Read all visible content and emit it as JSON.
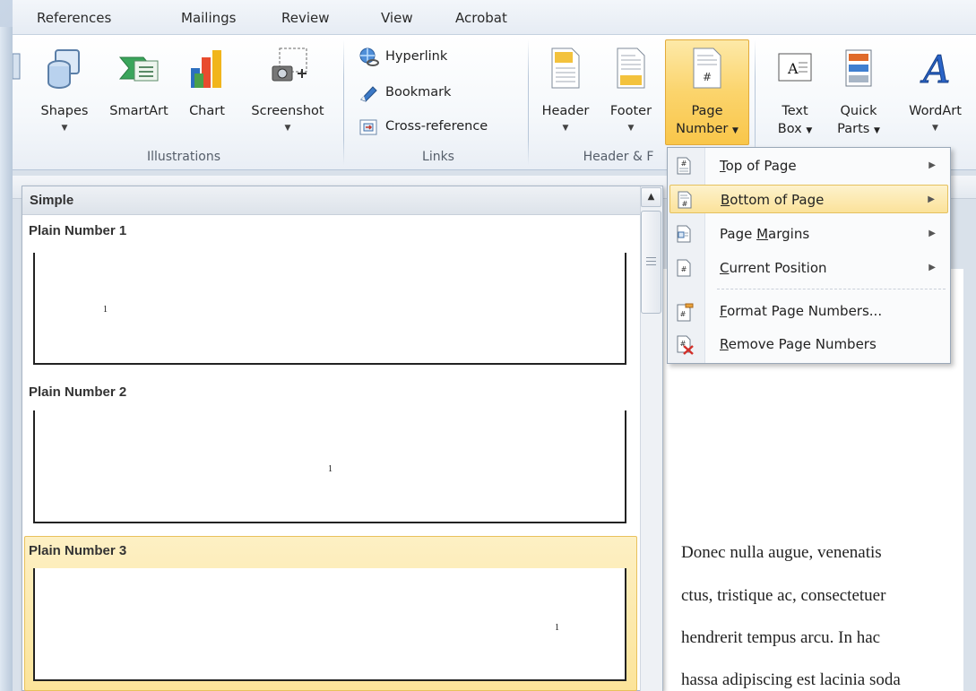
{
  "tabs": [
    "References",
    "Mailings",
    "Review",
    "View",
    "Acrobat"
  ],
  "ribbon": {
    "illustrations": {
      "label": "Illustrations",
      "buttons": [
        "Shapes",
        "SmartArt",
        "Chart",
        "Screenshot"
      ]
    },
    "links": {
      "label": "Links",
      "buttons": [
        "Hyperlink",
        "Bookmark",
        "Cross-reference"
      ]
    },
    "header_footer": {
      "label": "Header & F",
      "header": "Header",
      "footer": "Footer",
      "page_number_line1": "Page",
      "page_number_line2": "Number"
    },
    "text": {
      "text_box_line1": "Text",
      "text_box_line2": "Box",
      "quick_parts_line1": "Quick",
      "quick_parts_line2": "Parts",
      "wordart": "WordArt"
    }
  },
  "gallery": {
    "header": "Simple",
    "items": [
      {
        "title": "Plain Number 1",
        "number": "1"
      },
      {
        "title": "Plain Number 2",
        "number": "1"
      },
      {
        "title": "Plain Number 3",
        "number": "1"
      }
    ]
  },
  "menu": {
    "items": [
      {
        "accel": "T",
        "rest": "op of Page",
        "submenu": true
      },
      {
        "accel": "B",
        "rest": "ottom of Page",
        "submenu": true
      },
      {
        "accel": "",
        "pre": "Page ",
        "accel2": "M",
        "rest": "argins",
        "submenu": true
      },
      {
        "accel": "C",
        "rest": "urrent Position",
        "submenu": true
      },
      {
        "accel": "F",
        "rest": "ormat Page Numbers...",
        "submenu": false
      },
      {
        "accel": "R",
        "rest": "emove Page Numbers",
        "submenu": false
      }
    ]
  },
  "document": {
    "lines": [
      "Donec nulla augue, venenatis",
      "ctus, tristique ac, consectetuer",
      "hendrerit tempus arcu. In hac",
      "hassa adipiscing est lacinia soda"
    ]
  },
  "colors": {
    "highlight": "#fbe29a",
    "highlight_border": "#e5c15e",
    "ribbon_bg": "#f5f8fb"
  }
}
